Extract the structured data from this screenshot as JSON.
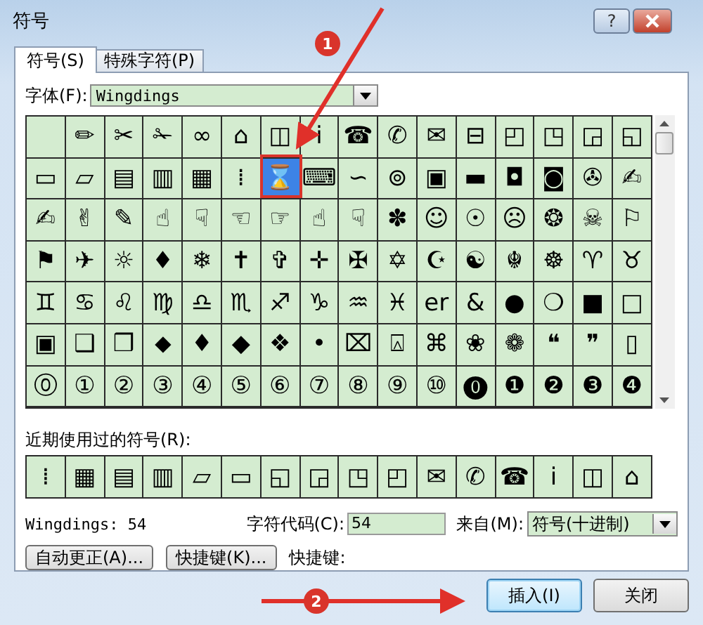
{
  "window": {
    "title": "符号",
    "help": "?"
  },
  "tabs": [
    {
      "label": "符号(S)",
      "selected": true
    },
    {
      "label": "特殊字符(P)",
      "selected": false
    }
  ],
  "font": {
    "label": "字体(F):",
    "value": "Wingdings"
  },
  "symbol_grid": {
    "rows": [
      {
        "cells": [
          {
            "selected": false
          },
          {
            "symbol": "✏",
            "selected": false
          },
          {
            "symbol": "✂",
            "selected": false
          },
          {
            "symbol": "✁",
            "selected": false
          },
          {
            "symbol": "∞",
            "selected": false
          },
          {
            "symbol": "⌂",
            "selected": false
          },
          {
            "symbol": "◫",
            "selected": false
          },
          {
            "symbol": "ⅰ",
            "selected": false
          },
          {
            "symbol": "☎",
            "selected": false
          },
          {
            "symbol": "✆",
            "selected": false
          },
          {
            "symbol": "✉",
            "selected": false
          },
          {
            "symbol": "⊟",
            "selected": false
          },
          {
            "symbol": "◰",
            "selected": false
          },
          {
            "symbol": "◳",
            "selected": false
          },
          {
            "symbol": "◲",
            "selected": false
          },
          {
            "symbol": "◱",
            "selected": false
          }
        ]
      },
      {
        "cells": [
          {
            "symbol": "▭",
            "selected": false
          },
          {
            "symbol": "▱",
            "selected": false
          },
          {
            "symbol": "▤",
            "selected": false
          },
          {
            "symbol": "▥",
            "selected": false
          },
          {
            "symbol": "▦",
            "selected": false
          },
          {
            "symbol": "⁞",
            "selected": false
          },
          {
            "symbol": "⌛",
            "selected": true
          },
          {
            "symbol": "⌨",
            "selected": false
          },
          {
            "symbol": "∽",
            "selected": false
          },
          {
            "symbol": "⊚",
            "selected": false
          },
          {
            "symbol": "▣",
            "selected": false
          },
          {
            "symbol": "▬",
            "selected": false
          },
          {
            "symbol": "◘",
            "selected": false
          },
          {
            "symbol": "◙",
            "selected": false
          },
          {
            "symbol": "✇",
            "selected": false
          },
          {
            "symbol": "✍",
            "selected": false
          }
        ]
      },
      {
        "cells": [
          {
            "symbol": "✍",
            "selected": false
          },
          {
            "symbol": "✌",
            "selected": false
          },
          {
            "symbol": "✎",
            "selected": false
          },
          {
            "symbol": "☝",
            "selected": false
          },
          {
            "symbol": "☟",
            "selected": false
          },
          {
            "symbol": "☜",
            "selected": false
          },
          {
            "symbol": "☞",
            "selected": false
          },
          {
            "symbol": "☝",
            "selected": false
          },
          {
            "symbol": "☟",
            "selected": false
          },
          {
            "symbol": "✽",
            "selected": false
          },
          {
            "symbol": "☺",
            "selected": false
          },
          {
            "symbol": "☉",
            "selected": false
          },
          {
            "symbol": "☹",
            "selected": false
          },
          {
            "symbol": "❂",
            "selected": false
          },
          {
            "symbol": "☠",
            "selected": false
          },
          {
            "symbol": "⚐",
            "selected": false
          }
        ]
      },
      {
        "cells": [
          {
            "symbol": "⚑",
            "selected": false
          },
          {
            "symbol": "✈",
            "selected": false
          },
          {
            "symbol": "☼",
            "selected": false
          },
          {
            "symbol": "♦",
            "selected": false
          },
          {
            "symbol": "❄",
            "selected": false
          },
          {
            "symbol": "✝",
            "selected": false
          },
          {
            "symbol": "✞",
            "selected": false
          },
          {
            "symbol": "✛",
            "selected": false
          },
          {
            "symbol": "✠",
            "selected": false
          },
          {
            "symbol": "✡",
            "selected": false
          },
          {
            "symbol": "☪",
            "selected": false
          },
          {
            "symbol": "☯",
            "selected": false
          },
          {
            "symbol": "☬",
            "selected": false
          },
          {
            "symbol": "☸",
            "selected": false
          },
          {
            "symbol": "♈",
            "selected": false
          },
          {
            "symbol": "♉",
            "selected": false
          }
        ]
      },
      {
        "cells": [
          {
            "symbol": "♊",
            "selected": false
          },
          {
            "symbol": "♋",
            "selected": false
          },
          {
            "symbol": "♌",
            "selected": false
          },
          {
            "symbol": "♍",
            "selected": false
          },
          {
            "symbol": "♎",
            "selected": false
          },
          {
            "symbol": "♏",
            "selected": false
          },
          {
            "symbol": "♐",
            "selected": false
          },
          {
            "symbol": "♑",
            "selected": false
          },
          {
            "symbol": "♒",
            "selected": false
          },
          {
            "symbol": "♓",
            "selected": false
          },
          {
            "symbol": "er",
            "selected": false
          },
          {
            "symbol": "&",
            "selected": false
          },
          {
            "symbol": "●",
            "selected": false
          },
          {
            "symbol": "❍",
            "selected": false
          },
          {
            "symbol": "■",
            "selected": false
          },
          {
            "symbol": "□",
            "selected": false
          }
        ]
      },
      {
        "cells": [
          {
            "symbol": "▣",
            "selected": false
          },
          {
            "symbol": "❑",
            "selected": false
          },
          {
            "symbol": "❒",
            "selected": false
          },
          {
            "symbol": "⬥",
            "selected": false
          },
          {
            "symbol": "♦",
            "selected": false
          },
          {
            "symbol": "◆",
            "selected": false
          },
          {
            "symbol": "❖",
            "selected": false
          },
          {
            "symbol": "•",
            "selected": false
          },
          {
            "symbol": "⌧",
            "selected": false
          },
          {
            "symbol": "⍓",
            "selected": false
          },
          {
            "symbol": "⌘",
            "selected": false
          },
          {
            "symbol": "❀",
            "selected": false
          },
          {
            "symbol": "❁",
            "selected": false
          },
          {
            "symbol": "❝",
            "selected": false
          },
          {
            "symbol": "❞",
            "selected": false
          },
          {
            "symbol": "▯",
            "selected": false
          }
        ]
      },
      {
        "cells": [
          {
            "symbol": "⓪",
            "selected": false
          },
          {
            "symbol": "①",
            "selected": false
          },
          {
            "symbol": "②",
            "selected": false
          },
          {
            "symbol": "③",
            "selected": false
          },
          {
            "symbol": "④",
            "selected": false
          },
          {
            "symbol": "⑤",
            "selected": false
          },
          {
            "symbol": "⑥",
            "selected": false
          },
          {
            "symbol": "⑦",
            "selected": false
          },
          {
            "symbol": "⑧",
            "selected": false
          },
          {
            "symbol": "⑨",
            "selected": false
          },
          {
            "symbol": "⑩",
            "selected": false
          },
          {
            "symbol": "⓿",
            "selected": false
          },
          {
            "symbol": "❶",
            "selected": false
          },
          {
            "symbol": "❷",
            "selected": false
          },
          {
            "symbol": "❸",
            "selected": false
          },
          {
            "symbol": "❹",
            "selected": false
          }
        ]
      }
    ]
  },
  "recent": {
    "label": "近期使用过的符号(R):",
    "symbols": [
      "⁞",
      "▦",
      "▤",
      "▥",
      "▱",
      "▭",
      "◱",
      "◲",
      "◳",
      "◰",
      "✉",
      "✆",
      "☎",
      "ⅰ",
      "◫",
      "⌂"
    ]
  },
  "info": {
    "font_code": "Wingdings: 54",
    "code_label": "字符代码(C):",
    "code_value": "54",
    "from_label": "来自(M):",
    "from_value": "符号(十进制)"
  },
  "buttons": [
    {
      "label": "自动更正(A)..."
    },
    {
      "label": "快捷键(K)..."
    }
  ],
  "shortcut_label": "快捷键:",
  "footer_buttons": [
    {
      "label": "插入(I)",
      "default": true
    },
    {
      "label": "关闭",
      "default": false
    }
  ],
  "annotations": [
    {
      "number": "1"
    },
    {
      "number": "2"
    }
  ]
}
